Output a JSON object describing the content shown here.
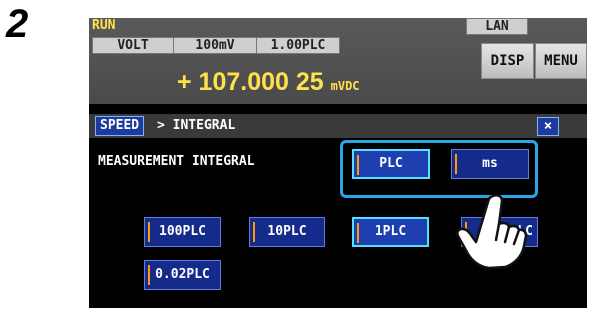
{
  "step_number": "2",
  "status": {
    "run": "RUN",
    "lan": "LAN"
  },
  "info_chips": [
    "VOLT",
    "100mV",
    "1.00PLC"
  ],
  "reading": {
    "value": "+ 107.000 25",
    "unit": "mVDC"
  },
  "top_buttons": {
    "disp": "DISP",
    "menu": "MENU"
  },
  "breadcrumb": {
    "current": "SPEED",
    "rest": "> INTEGRAL"
  },
  "close_label": "×",
  "measurement_label": "MEASUREMENT INTEGRAL",
  "unit_toggle": [
    {
      "label": "PLC",
      "selected": true
    },
    {
      "label": "ms",
      "selected": false
    }
  ],
  "plc_options": [
    {
      "label": "100PLC",
      "selected": false
    },
    {
      "label": "10PLC",
      "selected": false
    },
    {
      "label": "1PLC",
      "selected": true
    },
    {
      "label": ".PLC",
      "selected": false
    },
    {
      "label": "0.02PLC",
      "selected": false
    }
  ],
  "colors": {
    "screen_bg": "#000000",
    "status_yellow": "#ffe14d",
    "button_blue": "#142b8c",
    "selected_border": "#56e0ff",
    "highlight_box": "#2aa5e6",
    "accent_orange": "#ff9a00"
  },
  "icons": {
    "pointer": "hand-pointer-icon"
  }
}
